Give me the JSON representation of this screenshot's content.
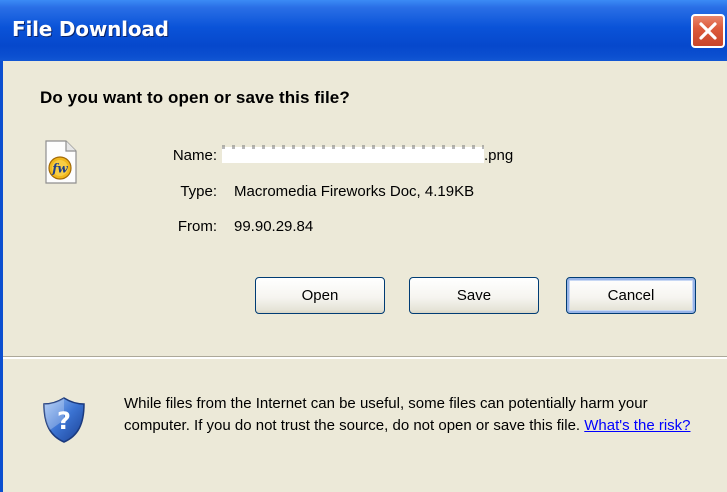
{
  "window": {
    "title": "File Download"
  },
  "dialog": {
    "question": "Do you want to open or save this file?",
    "file": {
      "name_label": "Name:",
      "name_value": ".png",
      "type_label": "Type:",
      "type_value": "Macromedia Fireworks Doc, 4.19KB",
      "from_label": "From:",
      "from_value": "99.90.29.84"
    },
    "buttons": {
      "open": "Open",
      "save": "Save",
      "cancel": "Cancel"
    },
    "warning": {
      "text": "While files from the Internet can be useful, some files can potentially harm your computer. If you do not trust the source, do not open or save this file.",
      "link": "What's the risk?"
    }
  },
  "icons": {
    "file": "fireworks-file-icon",
    "warning": "security-shield-icon",
    "close": "close-icon"
  },
  "colors": {
    "titlebar": "#0648cc",
    "close_button": "#dd5b3c",
    "dialog_bg": "#ece9d8",
    "link": "#0000ff"
  }
}
